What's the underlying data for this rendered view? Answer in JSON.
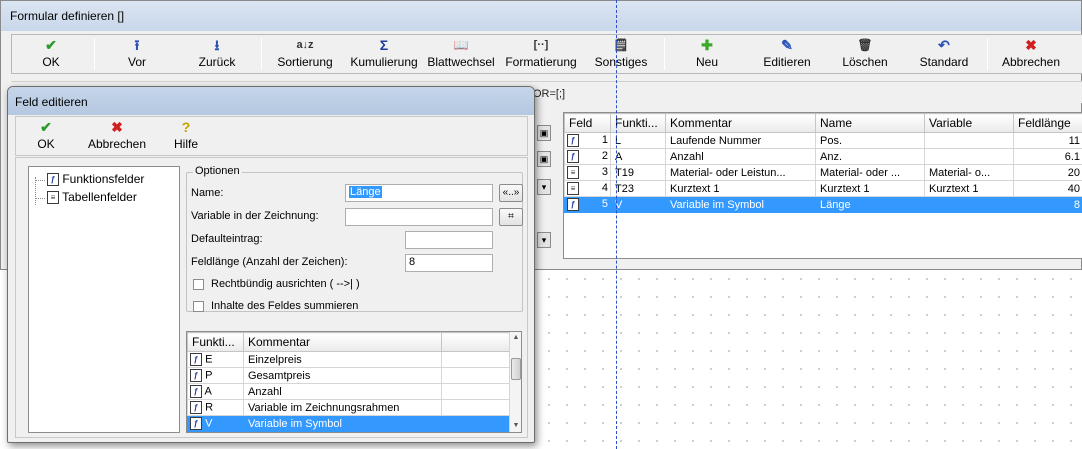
{
  "main_window": {
    "title": "Formular definieren []",
    "toolbar": [
      {
        "id": "ok",
        "label": "OK",
        "icon": "✔",
        "color": "#2e9a2e"
      },
      {
        "id": "vor",
        "label": "Vor",
        "icon": "⭱",
        "color": "#2850b8"
      },
      {
        "id": "zurueck",
        "label": "Zurück",
        "icon": "⭳",
        "color": "#2850b8"
      },
      {
        "id": "sortierung",
        "label": "Sortierung",
        "icon": "a↓z",
        "color": "#333333"
      },
      {
        "id": "kumulierung",
        "label": "Kumulierung",
        "icon": "Σ",
        "color": "#1e3c9a"
      },
      {
        "id": "blattwechsel",
        "label": "Blattwechsel",
        "icon": "📖",
        "color": "#2850b8"
      },
      {
        "id": "formatierung",
        "label": "Formatierung",
        "icon": "[··]",
        "color": "#333333"
      },
      {
        "id": "sonstiges",
        "label": "Sonstiges",
        "icon": "🗒",
        "color": "#333333"
      },
      {
        "id": "neu",
        "label": "Neu",
        "icon": "✚",
        "color": "#3caa28"
      },
      {
        "id": "editieren",
        "label": "Editieren",
        "icon": "✎",
        "color": "#2850b8"
      },
      {
        "id": "loeschen",
        "label": "Löschen",
        "icon": "🗑",
        "color": "#333333"
      },
      {
        "id": "standard",
        "label": "Standard",
        "icon": "↶",
        "color": "#2850b8"
      },
      {
        "id": "abbrechen",
        "label": "Abbrechen",
        "icon": "✖",
        "color": "#d02020"
      }
    ],
    "command_line": "OR=[;]",
    "grid": {
      "columns": [
        "Feld",
        "Funkti...",
        "Kommentar",
        "Name",
        "Variable",
        "Feldlänge"
      ],
      "rows": [
        {
          "num": "1",
          "funktion": "L",
          "kommentar": "Laufende Nummer",
          "name": "Pos.",
          "variable": "",
          "feldlaenge": "11",
          "icon": "fx",
          "selected": false
        },
        {
          "num": "2",
          "funktion": "A",
          "kommentar": "Anzahl",
          "name": "Anz.",
          "variable": "",
          "feldlaenge": "6.1",
          "icon": "fx",
          "selected": false
        },
        {
          "num": "3",
          "funktion": "T19",
          "kommentar": "Material- oder Leistun...",
          "name": "Material- oder ...",
          "variable": "Material- o...",
          "feldlaenge": "20",
          "icon": "doc",
          "selected": false
        },
        {
          "num": "4",
          "funktion": "T23",
          "kommentar": "Kurztext 1",
          "name": "Kurztext 1",
          "variable": "Kurztext 1",
          "feldlaenge": "40",
          "icon": "doc",
          "selected": false
        },
        {
          "num": "5",
          "funktion": "V",
          "kommentar": "Variable im Symbol",
          "name": "Länge",
          "variable": "",
          "feldlaenge": "8",
          "icon": "fx",
          "selected": true
        }
      ]
    }
  },
  "dialog": {
    "title": "Feld editieren",
    "toolbar": [
      {
        "id": "ok",
        "label": "OK",
        "icon": "✔",
        "color": "#2e9a2e"
      },
      {
        "id": "abbrechen",
        "label": "Abbrechen",
        "icon": "✖",
        "color": "#d02020"
      },
      {
        "id": "hilfe",
        "label": "Hilfe",
        "icon": "?",
        "color": "#c8a000"
      }
    ],
    "tree": {
      "items": [
        {
          "label": "Funktionsfelder",
          "icon": "fx"
        },
        {
          "label": "Tabellenfelder",
          "icon": "doc"
        }
      ]
    },
    "options": {
      "legend": "Optionen",
      "name_label": "Name:",
      "name_value": "Länge",
      "name_button": "«..»",
      "variable_label": "Variable in der Zeichnung:",
      "variable_value": "",
      "default_label": "Defaulteintrag:",
      "default_value": "",
      "length_label": "Feldlänge (Anzahl der Zeichen):",
      "length_value": "8",
      "right_align_label": "Rechtbündig ausrichten ( -->| )",
      "sum_label": "Inhalte des Feldes summieren"
    },
    "list": {
      "columns": [
        "Funkti...",
        "Kommentar",
        ""
      ],
      "rows": [
        {
          "funktion": "E",
          "kommentar": "Einzelpreis",
          "selected": false
        },
        {
          "funktion": "P",
          "kommentar": "Gesamtpreis",
          "selected": false
        },
        {
          "funktion": "A",
          "kommentar": "Anzahl",
          "selected": false
        },
        {
          "funktion": "R",
          "kommentar": "Variable im Zeichnungsrahmen",
          "selected": false
        },
        {
          "funktion": "V",
          "kommentar": "Variable im Symbol",
          "selected": true
        }
      ]
    }
  }
}
